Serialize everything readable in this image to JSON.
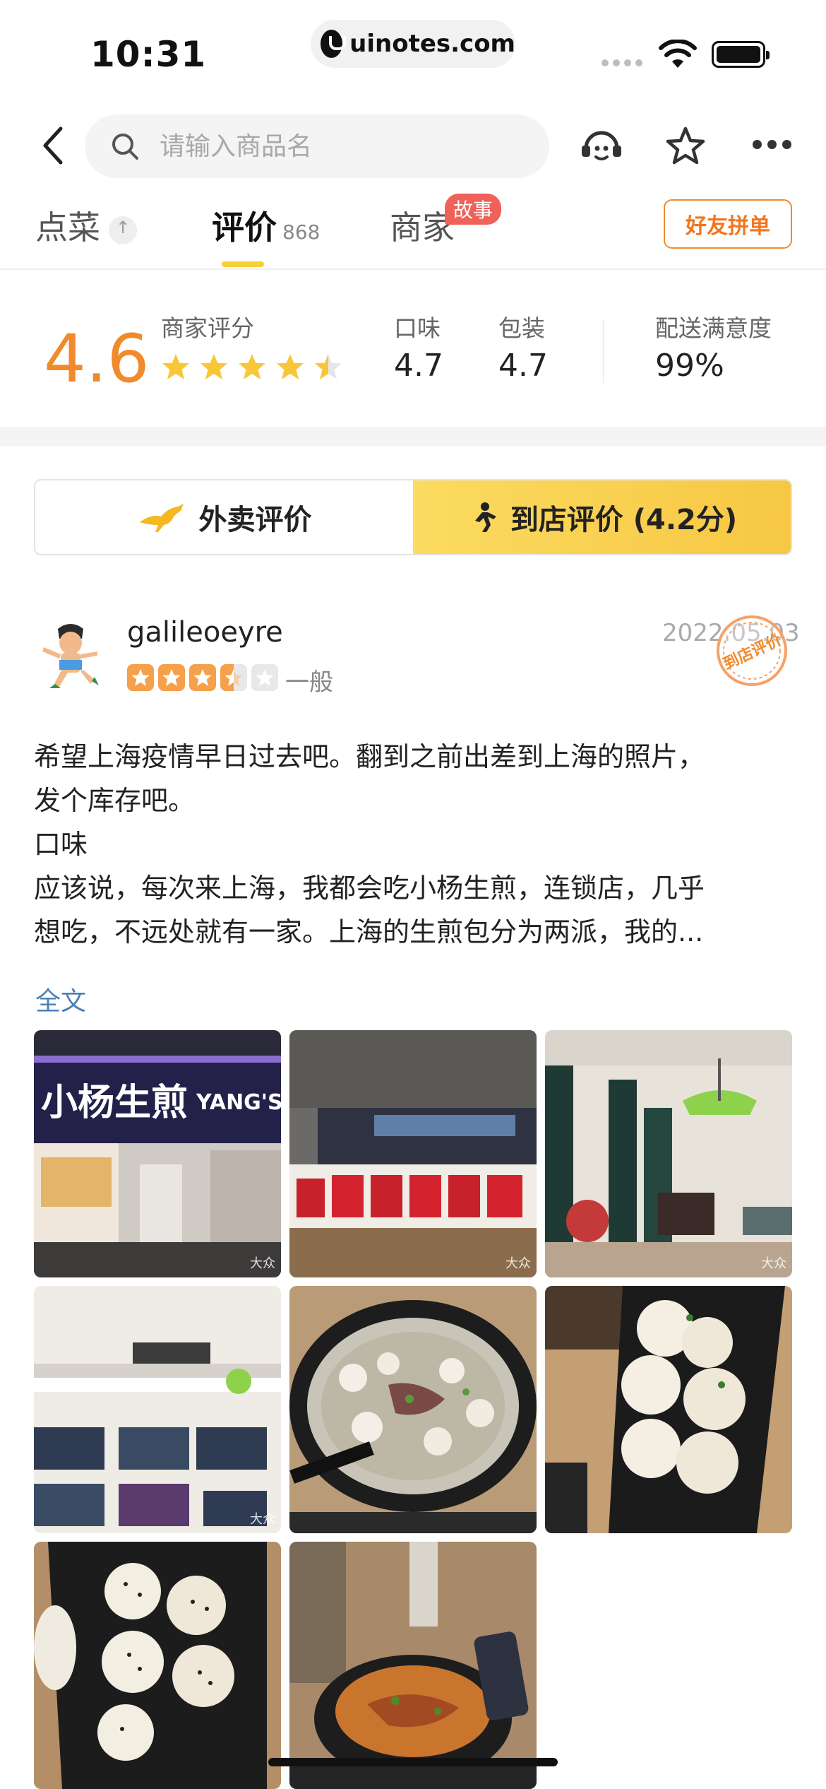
{
  "status_bar": {
    "time": "10:31",
    "url": "uinotes.com"
  },
  "header": {
    "search_placeholder": "请输入商品名",
    "icons": [
      "back-icon",
      "search-icon",
      "customer-service-icon",
      "star-icon",
      "more-icon"
    ]
  },
  "tabs": {
    "order": "点菜",
    "review": "评价",
    "review_count": "868",
    "merchant": "商家",
    "merchant_badge": "故事",
    "group_button": "好友拼单"
  },
  "scores": {
    "overall": "4.6",
    "merchant_label": "商家评分",
    "merchant_stars": 4.5,
    "taste_label": "口味",
    "taste_value": "4.7",
    "pack_label": "包装",
    "pack_value": "4.7",
    "delivery_label": "配送满意度",
    "delivery_value": "99%"
  },
  "segment": {
    "takeout_label": "外卖评价",
    "store_label": "到店评价 (4.2分)",
    "selected": "store"
  },
  "review": {
    "username": "galileoeyre",
    "date": "2022.05.03",
    "stamp_text": "到店评价",
    "stars": 3.5,
    "rating_text": "一般",
    "lines": [
      "希望上海疫情早日过去吧。翻到之前出差到上海的照片，",
      "发个库存吧。",
      "口味",
      "应该说，每次来上海，我都会吃小杨生煎，连锁店，几乎",
      "想吃，不远处就有一家。上海的生煎包分为两派，我的..."
    ],
    "full_text_link": "全文",
    "photo_watermark": "大众",
    "photo_sign_text": "小杨生煎",
    "photo_sign_en": "YANG'S DUMPLING"
  },
  "colors": {
    "accent_orange": "#f08a2c",
    "star_yellow": "#f8c637",
    "segment_yellow": "#f7c743",
    "link_blue": "#4a7fb5",
    "badge_red": "#f0615a"
  }
}
